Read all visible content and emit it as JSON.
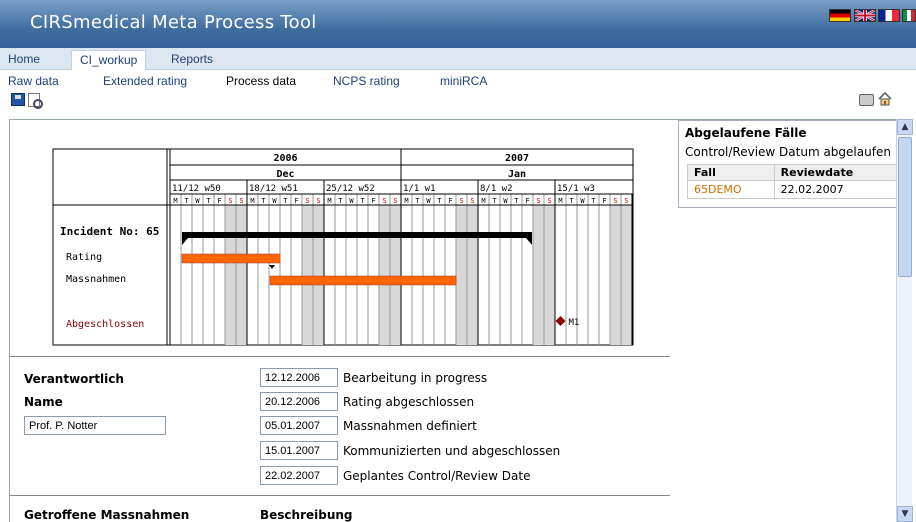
{
  "app": {
    "title": "CIRSmedical Meta Process Tool"
  },
  "flags": [
    "german-flag-icon",
    "uk-flag-icon",
    "french-flag-icon",
    "italian-flag-icon"
  ],
  "nav1": [
    "Home",
    "CI_workup",
    "Reports"
  ],
  "nav2": [
    "Raw data",
    "Extended rating",
    "Process data",
    "NCPS rating",
    "miniRCA"
  ],
  "gantt": {
    "years": [
      "2006",
      "2007"
    ],
    "months": [
      "Dec",
      "Jan"
    ],
    "weeks": [
      "11/12 w50",
      "18/12 w51",
      "25/12 w52",
      "1/1 w1",
      "8/1 w2",
      "15/1 w3"
    ],
    "days": [
      "M",
      "T",
      "W",
      "T",
      "F",
      "S",
      "S"
    ],
    "incident_label": "Incident No: 65",
    "rows": [
      "Rating",
      "Massnahmen"
    ],
    "closed_label": "Abgeschlossen",
    "milestone_label": "M1"
  },
  "right_panel": {
    "title": "Abgelaufene Fälle",
    "subtitle": "Control/Review Datum abgelaufen",
    "col_fall": "Fall",
    "col_reviewdate": "Reviewdate",
    "row_fall": "65DEMO",
    "row_reviewdate": "22.02.2007"
  },
  "form": {
    "verantwortlich_label": "Verantwortlich",
    "name_label": "Name",
    "name_value": "Prof. P. Notter",
    "dates": [
      {
        "value": "12.12.2006",
        "desc": "Bearbeitung in progress"
      },
      {
        "value": "20.12.2006",
        "desc": "Rating abgeschlossen"
      },
      {
        "value": "05.01.2007",
        "desc": "Massnahmen definiert"
      },
      {
        "value": "15.01.2007",
        "desc": "Kommunizierten und abgeschlossen"
      },
      {
        "value": "22.02.2007",
        "desc": "Geplantes Control/Review Date"
      }
    ],
    "massnahmen_label": "Getroffene Massnahmen",
    "beschreibung_label": "Beschreibung"
  },
  "colors": {
    "title_bar": "#3f6d9f",
    "nav_bg": "#dce6f0",
    "bar_black": "#000000",
    "bar_orange": "#ff6600",
    "closed_label": "#8b0000",
    "milestone": "#8b0000",
    "link": "#c87000"
  }
}
